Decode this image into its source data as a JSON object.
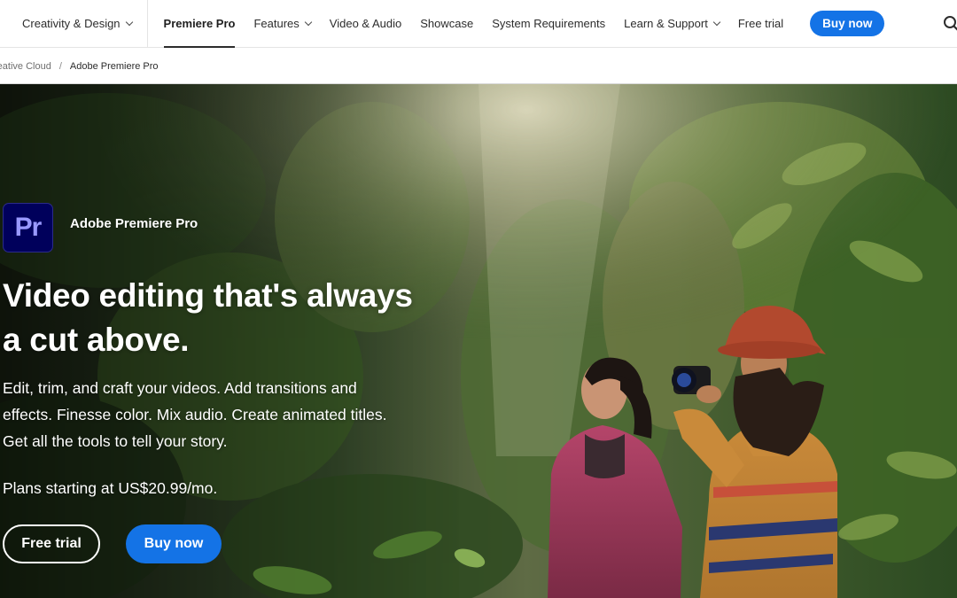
{
  "nav": {
    "category": "Creativity & Design",
    "items": [
      {
        "label": "Premiere Pro",
        "active": true,
        "dropdown": false
      },
      {
        "label": "Features",
        "active": false,
        "dropdown": true
      },
      {
        "label": "Video & Audio",
        "active": false,
        "dropdown": false
      },
      {
        "label": "Showcase",
        "active": false,
        "dropdown": false
      },
      {
        "label": "System Requirements",
        "active": false,
        "dropdown": false
      },
      {
        "label": "Learn & Support",
        "active": false,
        "dropdown": true
      },
      {
        "label": "Free trial",
        "active": false,
        "dropdown": false
      }
    ],
    "buy_label": "Buy now",
    "search_icon": "search-icon"
  },
  "breadcrumb": {
    "items": [
      "reative Cloud",
      "Adobe Premiere Pro"
    ],
    "separator": "/"
  },
  "hero": {
    "logo_text": "Pr",
    "product_name": "Adobe Premiere Pro",
    "headline_line1": "Video editing that's always",
    "headline_line2": "a cut above.",
    "desc_line1": "Edit, trim, and craft your videos. Add transitions and",
    "desc_line2": "effects. Finesse color. Mix audio. Create animated titles.",
    "desc_line3": "Get all the tools to tell your story.",
    "price": "Plans starting at US$20.99/mo.",
    "free_trial_label": "Free trial",
    "buy_label": "Buy now"
  },
  "colors": {
    "accent": "#1473e6",
    "logo_bg": "#00005b",
    "logo_text": "#9999ff"
  }
}
